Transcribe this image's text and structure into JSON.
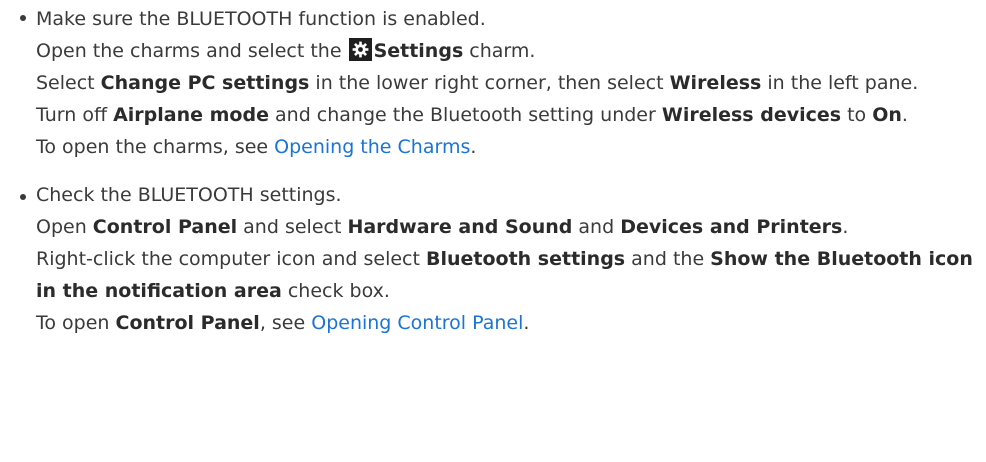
{
  "item1": {
    "bullet": "Make sure the BLUETOOTH function is enabled.",
    "l2_a": "Open the charms and select the ",
    "l2_b": "Settings",
    "l2_c": " charm.",
    "l3_a": "Select ",
    "l3_b": "Change PC settings",
    "l3_c": " in the lower right corner, then select ",
    "l3_d": "Wireless",
    "l3_e": " in the left pane.",
    "l4_a": "Turn off ",
    "l4_b": "Airplane mode",
    "l4_c": " and change the Bluetooth setting under ",
    "l4_d": "Wireless devices",
    "l4_e": " to ",
    "l4_f": "On",
    "l4_g": ".",
    "l5_a": "To open the charms, see ",
    "l5_link": "Opening the Charms",
    "l5_b": "."
  },
  "item2": {
    "bullet": "Check the BLUETOOTH settings.",
    "l2_a": "Open ",
    "l2_b": "Control Panel",
    "l2_c": " and select ",
    "l2_d": "Hardware and Sound",
    "l2_e": " and ",
    "l2_f": "Devices and Printers",
    "l2_g": ".",
    "l3_a": "Right-click the computer icon and select ",
    "l3_b": "Bluetooth settings",
    "l3_c": " and the ",
    "l3_d": "Show the Bluetooth icon in the notification area",
    "l3_e": " check box.",
    "l4_a": "To open ",
    "l4_b": "Control Panel",
    "l4_c": ", see ",
    "l4_link": "Opening Control Panel",
    "l4_d": "."
  },
  "icons": {
    "settings": "gear-icon"
  }
}
